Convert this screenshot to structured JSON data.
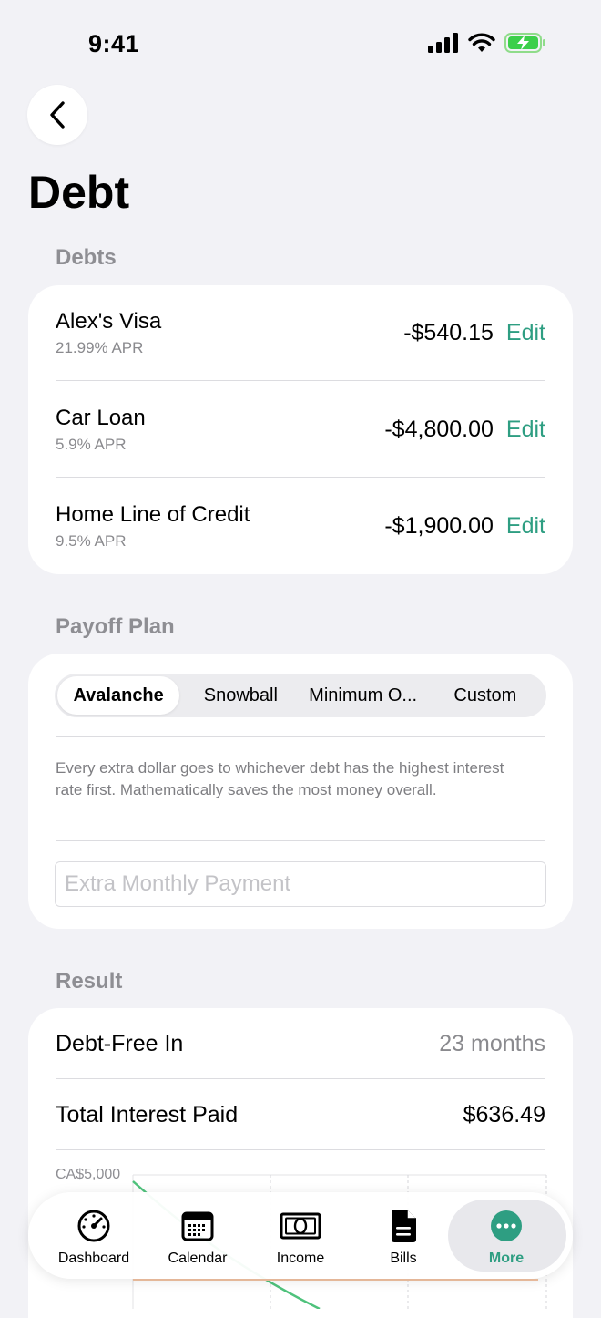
{
  "status": {
    "time": "9:41"
  },
  "header": {
    "title": "Debt"
  },
  "colors": {
    "accent": "#2e9e82",
    "secondary_text": "#8e8e93",
    "background": "#f2f2f6"
  },
  "debts": {
    "section_title": "Debts",
    "edit_label": "Edit",
    "items": [
      {
        "name": "Alex's Visa",
        "apr": "21.99% APR",
        "amount": "-$540.15"
      },
      {
        "name": "Car Loan",
        "apr": "5.9% APR",
        "amount": "-$4,800.00"
      },
      {
        "name": "Home Line of Credit",
        "apr": "9.5% APR",
        "amount": "-$1,900.00"
      }
    ]
  },
  "payoff": {
    "section_title": "Payoff Plan",
    "options": [
      "Avalanche",
      "Snowball",
      "Minimum O...",
      "Custom"
    ],
    "selected": "Avalanche",
    "description": "Every extra dollar goes to whichever debt has the highest interest rate first. Mathematically saves the most money overall.",
    "extra_payment": {
      "value": "",
      "placeholder": "Extra Monthly Payment"
    }
  },
  "result": {
    "section_title": "Result",
    "debt_free_label": "Debt-Free In",
    "debt_free_value": "23 months",
    "interest_label": "Total Interest Paid",
    "interest_value": "$636.49",
    "chart_axis_top": "CA$5,000"
  },
  "tabbar": {
    "items": [
      {
        "label": "Dashboard",
        "icon": "speedometer-icon"
      },
      {
        "label": "Calendar",
        "icon": "calendar-icon"
      },
      {
        "label": "Income",
        "icon": "banknote-icon"
      },
      {
        "label": "Bills",
        "icon": "document-icon"
      },
      {
        "label": "More",
        "icon": "ellipsis-circle-icon"
      }
    ],
    "active": "More"
  }
}
